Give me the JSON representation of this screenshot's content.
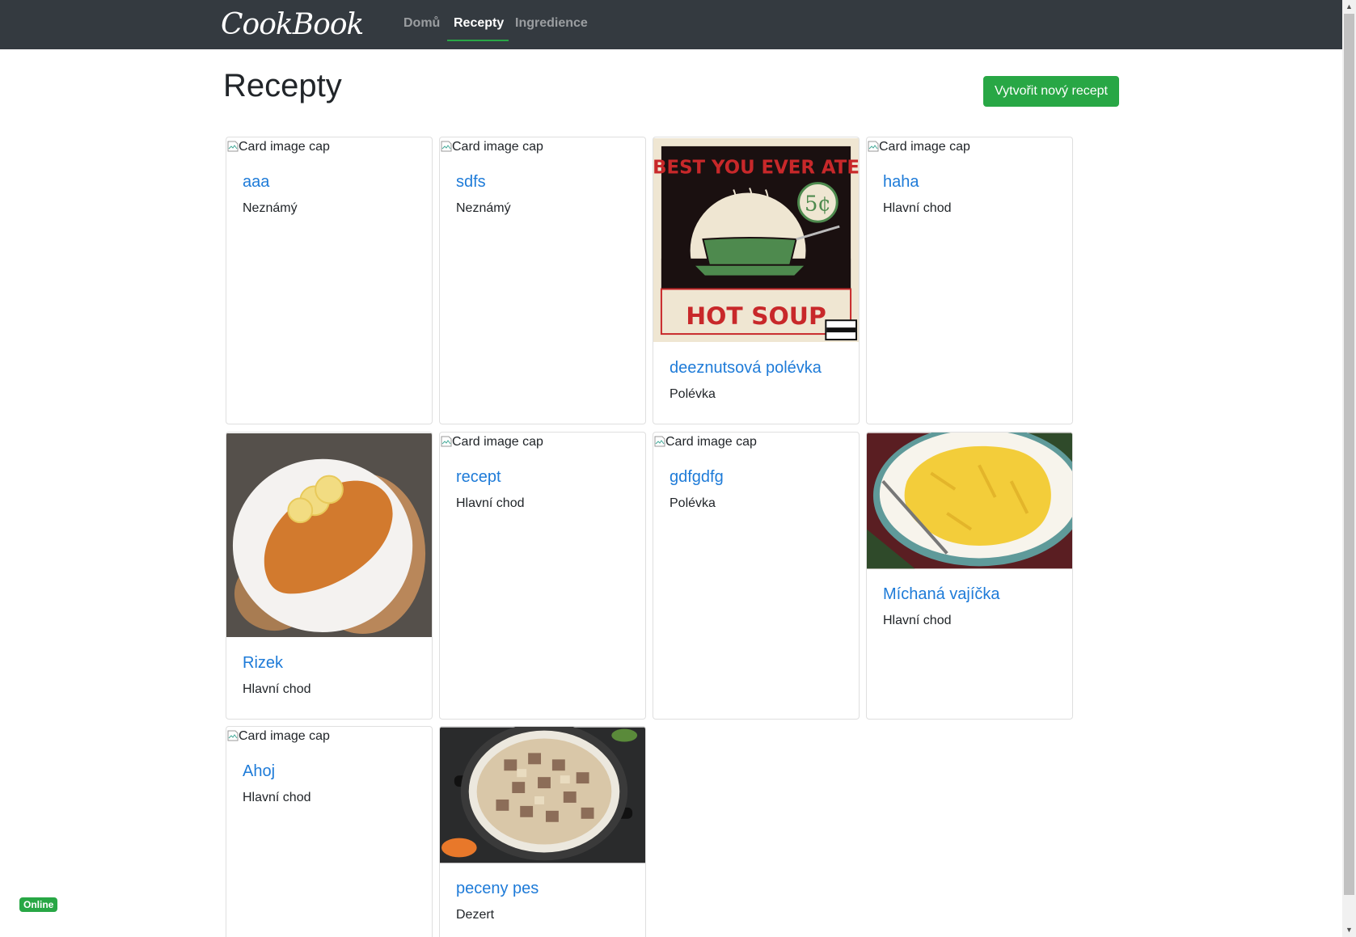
{
  "brand": "CookBook",
  "nav": {
    "home": "Domů",
    "recipes": "Recepty",
    "ingredients": "Ingredience"
  },
  "page": {
    "title": "Recepty",
    "create_button": "Vytvořit nový recept"
  },
  "card_image_alt": "Card image cap",
  "recipes": [
    {
      "title": "aaa",
      "category": "Neznámý",
      "image": "broken"
    },
    {
      "title": "sdfs",
      "category": "Neznámý",
      "image": "broken"
    },
    {
      "title": "deeznutsová polévka",
      "category": "Polévka",
      "image": "hot-soup-poster"
    },
    {
      "title": "haha",
      "category": "Hlavní chod",
      "image": "broken"
    },
    {
      "title": "Rizek",
      "category": "Hlavní chod",
      "image": "schnitzel-photo"
    },
    {
      "title": "recept",
      "category": "Hlavní chod",
      "image": "broken"
    },
    {
      "title": "gdfgdfg",
      "category": "Polévka",
      "image": "broken"
    },
    {
      "title": "Míchaná vajíčka",
      "category": "Hlavní chod",
      "image": "scrambled-eggs-photo"
    },
    {
      "title": "Ahoj",
      "category": "Hlavní chod",
      "image": "broken"
    },
    {
      "title": "peceny pes",
      "category": "Dezert",
      "image": "stew-pot-photo"
    }
  ],
  "poster_text": {
    "top": "BEST YOU EVER ATE",
    "price": "5¢",
    "bottom": "HOT SOUP"
  },
  "status_badge": "Online",
  "colors": {
    "navbar": "#343a40",
    "accent_green": "#28a745",
    "link_blue": "#1e7bd8"
  }
}
